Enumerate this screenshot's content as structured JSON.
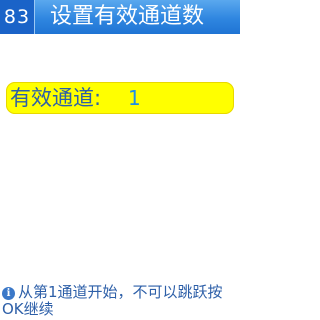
{
  "header": {
    "screen_number": "83",
    "title": "设置有效通道数"
  },
  "setting": {
    "label": "有效通道:",
    "value": "1"
  },
  "hint": {
    "icon": "info-icon",
    "text": "从第1通道开始，不可以跳跃按OK继续"
  },
  "colors": {
    "header_blue": "#2f86e0",
    "highlight_yellow": "#ffff00",
    "text_blue": "#2d5fa8"
  }
}
